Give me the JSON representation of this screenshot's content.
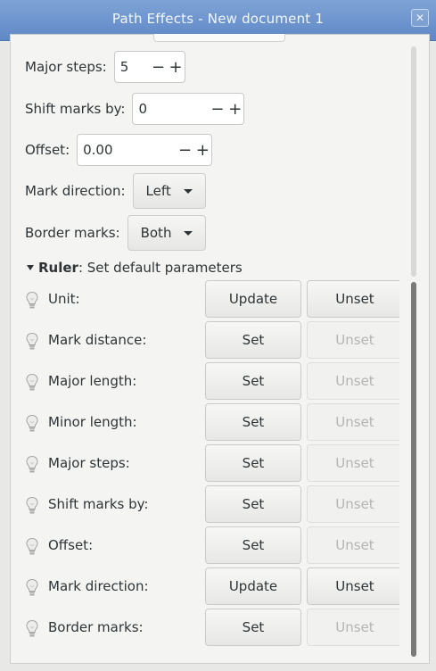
{
  "window": {
    "title": "Path Effects - New document 1",
    "close_glyph": "✕"
  },
  "params": [
    {
      "label": "Major steps:",
      "kind": "spin",
      "value": "5"
    },
    {
      "label": "Shift marks by:",
      "kind": "spin",
      "value": "0"
    },
    {
      "label": "Offset:",
      "kind": "spin",
      "value": "0.00"
    },
    {
      "label": "Mark direction:",
      "kind": "combo",
      "value": "Left"
    },
    {
      "label": "Border marks:",
      "kind": "combo",
      "value": "Both"
    }
  ],
  "spin_minus": "−",
  "spin_plus": "+",
  "section": {
    "name": "Ruler",
    "text": ": Set default parameters"
  },
  "defaults": [
    {
      "label": "Unit:",
      "set": "Update",
      "unset": "Unset",
      "unset_enabled": true
    },
    {
      "label": "Mark distance:",
      "set": "Set",
      "unset": "Unset",
      "unset_enabled": false
    },
    {
      "label": "Major length:",
      "set": "Set",
      "unset": "Unset",
      "unset_enabled": false
    },
    {
      "label": "Minor length:",
      "set": "Set",
      "unset": "Unset",
      "unset_enabled": false
    },
    {
      "label": "Major steps:",
      "set": "Set",
      "unset": "Unset",
      "unset_enabled": false
    },
    {
      "label": "Shift marks by:",
      "set": "Set",
      "unset": "Unset",
      "unset_enabled": false
    },
    {
      "label": "Offset:",
      "set": "Set",
      "unset": "Unset",
      "unset_enabled": false
    },
    {
      "label": "Mark direction:",
      "set": "Update",
      "unset": "Unset",
      "unset_enabled": true
    },
    {
      "label": "Border marks:",
      "set": "Set",
      "unset": "Unset",
      "unset_enabled": false
    }
  ],
  "icons": {
    "bulb": "lightbulb-icon",
    "section_toggle": "expander-triangle-icon"
  }
}
